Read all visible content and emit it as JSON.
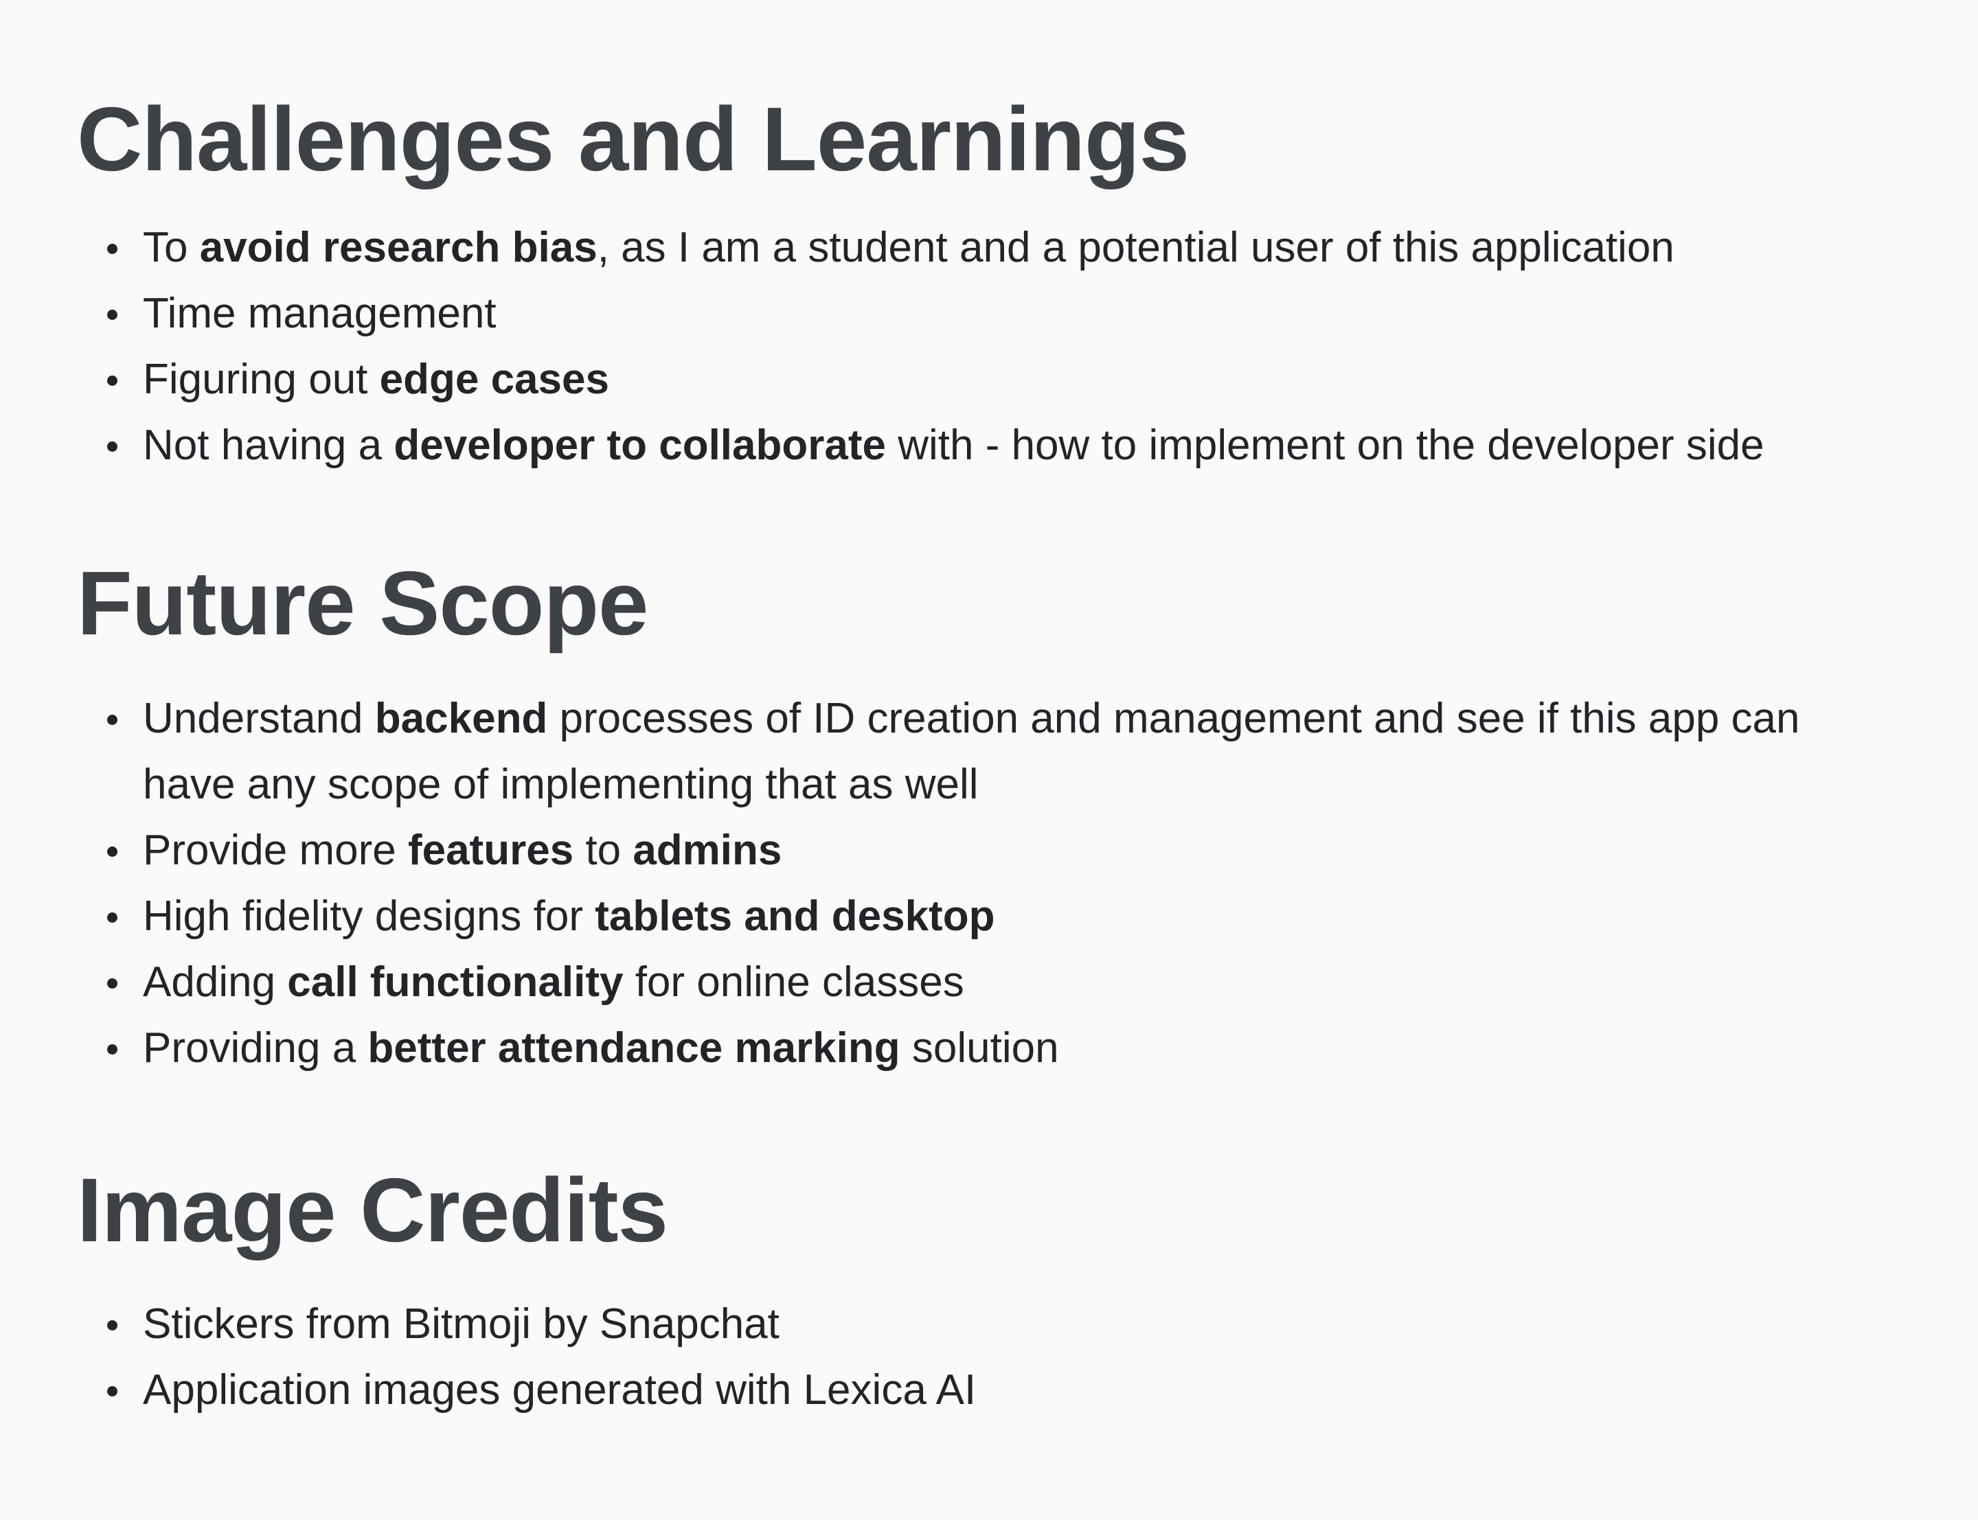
{
  "sections": [
    {
      "heading": "Challenges and Learnings",
      "items": [
        {
          "t0": "To ",
          "b0": "avoid research bias",
          "t1": ", as I am a student and a potential user of this application"
        },
        {
          "t0": "Time management"
        },
        {
          "t0": "Figuring out ",
          "b0": "edge cases"
        },
        {
          "t0": "Not having a ",
          "b0": "developer to collaborate",
          "t1": " with - how to implement on the developer side"
        }
      ]
    },
    {
      "heading": "Future Scope",
      "items": [
        {
          "t0": "Understand ",
          "b0": "backend",
          "t1": " processes of ID creation and management and see if this app can have any scope of implementing that as well"
        },
        {
          "t0": "Provide more ",
          "b0": "features",
          "t1": " to ",
          "b1": "admins"
        },
        {
          "t0": "High fidelity designs for ",
          "b0": "tablets and desktop"
        },
        {
          "t0": "Adding ",
          "b0": "call functionality",
          "t1": " for online classes"
        },
        {
          "t0": "Providing a ",
          "b0": "better attendance marking",
          "t1": " solution"
        }
      ]
    },
    {
      "heading": "Image Credits",
      "items": [
        {
          "t0": "Stickers from Bitmoji by Snapchat"
        },
        {
          "t0": "Application images generated with Lexica AI"
        }
      ]
    }
  ]
}
